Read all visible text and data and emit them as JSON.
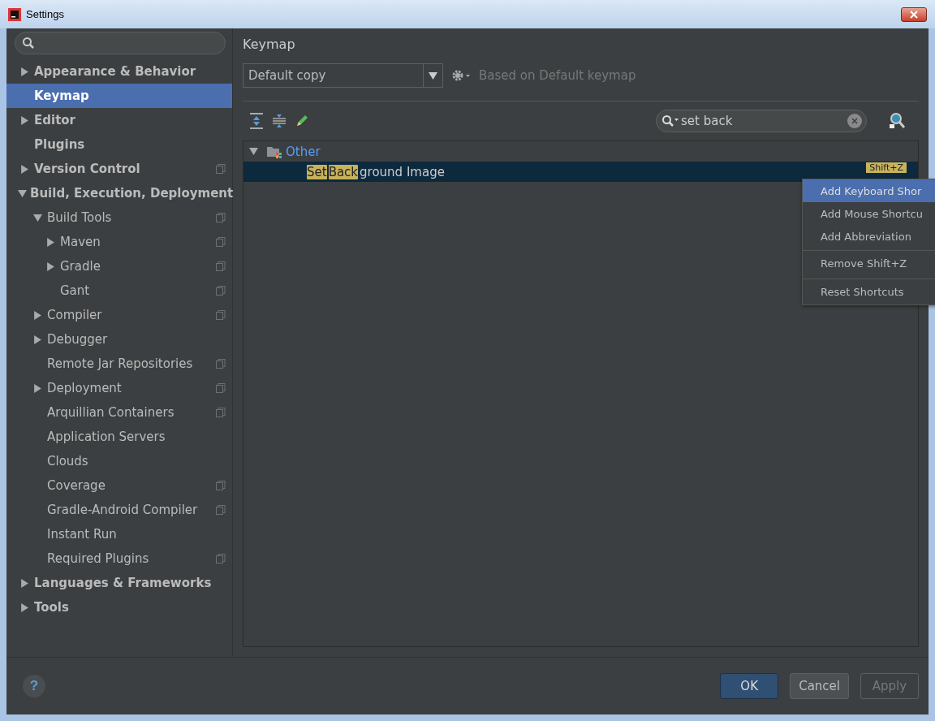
{
  "window": {
    "title": "Settings"
  },
  "sidebar": {
    "items": [
      {
        "label": "Appearance & Behavior",
        "expanded": false,
        "selected": false,
        "project_level": false
      },
      {
        "label": "Keymap",
        "selected": true,
        "project_level": false
      },
      {
        "label": "Editor",
        "expanded": false,
        "selected": false,
        "project_level": false
      },
      {
        "label": "Plugins",
        "selected": false,
        "project_level": false
      },
      {
        "label": "Version Control",
        "expanded": false,
        "selected": false,
        "project_level": true
      },
      {
        "label": "Build, Execution, Deployment",
        "expanded": true,
        "selected": false,
        "project_level": false,
        "children": [
          {
            "label": "Build Tools",
            "expanded": true,
            "selected": false,
            "project_level": true,
            "children": [
              {
                "label": "Maven",
                "expanded": false,
                "selected": false,
                "project_level": true
              },
              {
                "label": "Gradle",
                "expanded": false,
                "selected": false,
                "project_level": true
              },
              {
                "label": "Gant",
                "selected": false,
                "project_level": true
              }
            ]
          },
          {
            "label": "Compiler",
            "expanded": false,
            "selected": false,
            "project_level": true
          },
          {
            "label": "Debugger",
            "expanded": false,
            "selected": false,
            "project_level": false
          },
          {
            "label": "Remote Jar Repositories",
            "selected": false,
            "project_level": true
          },
          {
            "label": "Deployment",
            "expanded": false,
            "selected": false,
            "project_level": true
          },
          {
            "label": "Arquillian Containers",
            "selected": false,
            "project_level": true
          },
          {
            "label": "Application Servers",
            "selected": false,
            "project_level": false
          },
          {
            "label": "Clouds",
            "selected": false,
            "project_level": false
          },
          {
            "label": "Coverage",
            "selected": false,
            "project_level": true
          },
          {
            "label": "Gradle-Android Compiler",
            "selected": false,
            "project_level": true
          },
          {
            "label": "Instant Run",
            "selected": false,
            "project_level": false
          },
          {
            "label": "Required Plugins",
            "selected": false,
            "project_level": true
          }
        ]
      },
      {
        "label": "Languages & Frameworks",
        "expanded": false,
        "selected": false,
        "project_level": false
      },
      {
        "label": "Tools",
        "expanded": false,
        "selected": false,
        "project_level": false
      }
    ]
  },
  "keymap": {
    "title": "Keymap",
    "scheme": "Default copy",
    "based_on": "Based on Default keymap",
    "search": {
      "value": "set back"
    },
    "tree": [
      {
        "label": "Other",
        "expanded": true,
        "children": [
          {
            "segments": [
              {
                "text": "Set",
                "match": true
              },
              {
                "text": "Back",
                "match": true
              },
              {
                "text": "ground Image",
                "match": false
              }
            ],
            "selected": true,
            "shortcut": "Shift+Z"
          }
        ]
      }
    ]
  },
  "context_menu": {
    "items": [
      {
        "label": "Add Keyboard Shor",
        "selected": true,
        "separator_before": false
      },
      {
        "label": "Add Mouse Shortcu",
        "selected": false,
        "separator_before": false
      },
      {
        "label": "Add Abbreviation",
        "selected": false,
        "separator_before": false
      },
      {
        "label": "Remove Shift+Z",
        "selected": false,
        "separator_before": true
      },
      {
        "label": "Reset Shortcuts",
        "selected": false,
        "separator_before": true
      }
    ]
  },
  "footer": {
    "help": "?",
    "buttons": [
      {
        "label": "OK",
        "kind": "default",
        "disabled": false
      },
      {
        "label": "Cancel",
        "kind": "normal",
        "disabled": false
      },
      {
        "label": "Apply",
        "kind": "normal",
        "disabled": true
      }
    ]
  }
}
